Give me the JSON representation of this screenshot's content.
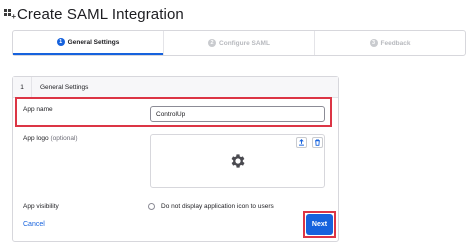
{
  "header": {
    "title": "Create SAML Integration",
    "icon": "grid-plus-icon"
  },
  "stepper": {
    "steps": [
      {
        "number": "1",
        "label": "General Settings",
        "state": "active"
      },
      {
        "number": "2",
        "label": "Configure SAML",
        "state": "inactive"
      },
      {
        "number": "3",
        "label": "Feedback",
        "state": "inactive"
      }
    ]
  },
  "section": {
    "number": "1",
    "title": "General Settings"
  },
  "form": {
    "app_name": {
      "label": "App name",
      "value": "ControlUp"
    },
    "app_logo": {
      "label": "App logo",
      "optional": "(optional)",
      "placeholder_icon": "gear-icon"
    },
    "app_visibility": {
      "label": "App visibility",
      "option": "Do not display application icon to users",
      "checked": false
    }
  },
  "actions": {
    "cancel": "Cancel",
    "next": "Next"
  },
  "colors": {
    "primary": "#1662dd",
    "highlight": "#dc3545",
    "border": "#d7d7dc"
  }
}
